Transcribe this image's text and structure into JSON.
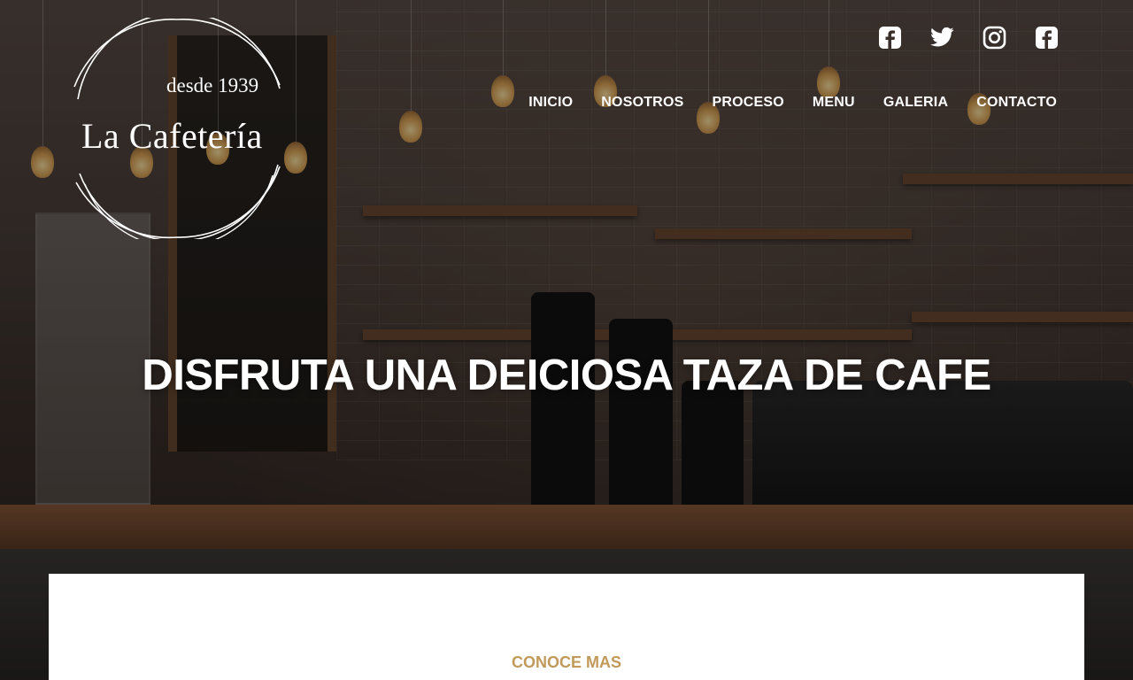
{
  "logo": {
    "since": "desde 1939",
    "name": "La Cafetería"
  },
  "social": [
    {
      "icon": "facebook-square-icon"
    },
    {
      "icon": "twitter-icon"
    },
    {
      "icon": "instagram-icon"
    },
    {
      "icon": "facebook-square-icon"
    }
  ],
  "nav": {
    "items": [
      {
        "label": "INICIO"
      },
      {
        "label": "NOSOTROS"
      },
      {
        "label": "PROCESO"
      },
      {
        "label": "MENU"
      },
      {
        "label": "GALERIA"
      },
      {
        "label": "CONTACTO"
      }
    ]
  },
  "hero": {
    "headline": "DISFRUTA UNA DEICIOSA TAZA DE CAFE"
  },
  "panel": {
    "link_label": "CONOCE MAS"
  },
  "colors": {
    "accent": "#c19a5b",
    "text_light": "#ffffff",
    "panel_bg": "#ffffff"
  }
}
